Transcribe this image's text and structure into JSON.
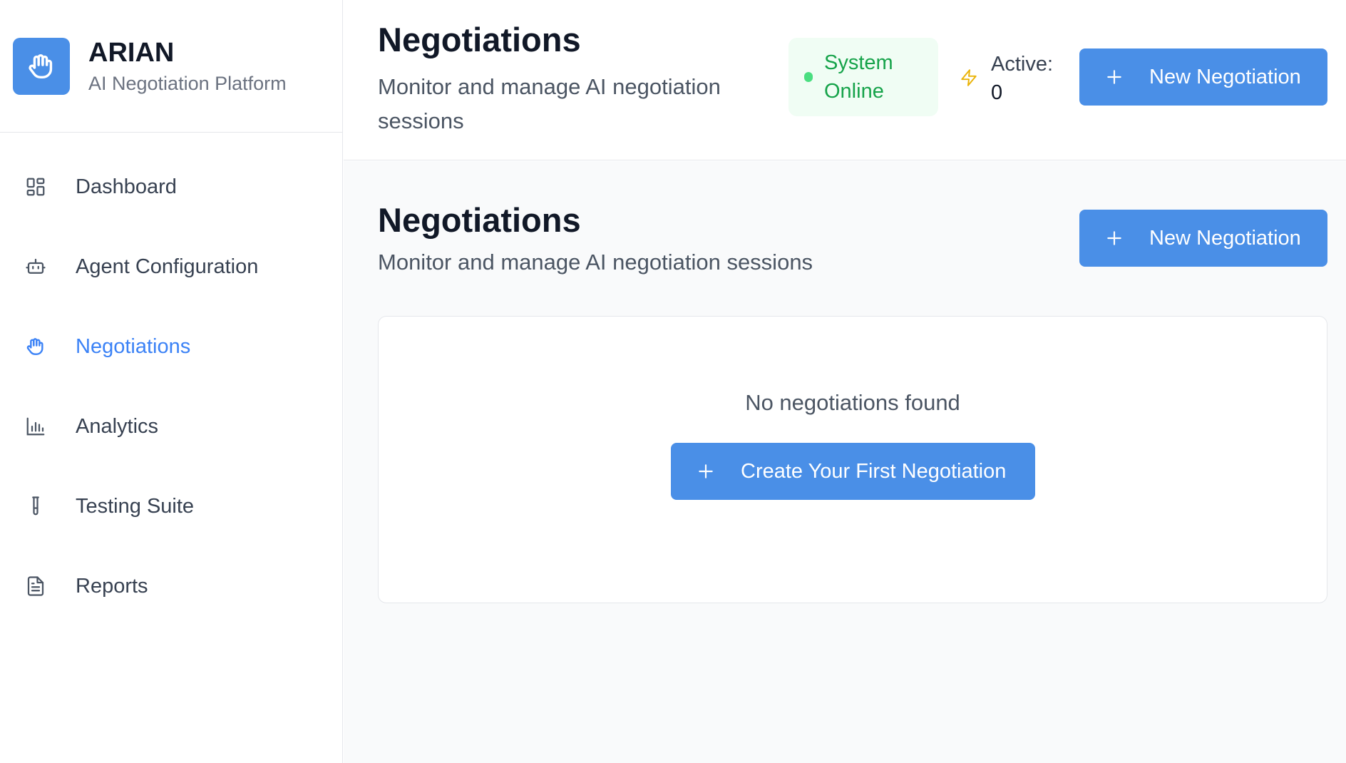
{
  "brand": {
    "name": "ARIAN",
    "subtitle": "AI Negotiation Platform",
    "logo_icon": "hand-icon",
    "accent_color": "#4a8fe7"
  },
  "sidebar": {
    "items": [
      {
        "label": "Dashboard",
        "icon": "grid-icon",
        "active": false
      },
      {
        "label": "Agent Configuration",
        "icon": "robot-icon",
        "active": false
      },
      {
        "label": "Negotiations",
        "icon": "hand-icon",
        "active": true
      },
      {
        "label": "Analytics",
        "icon": "bar-chart-icon",
        "active": false
      },
      {
        "label": "Testing Suite",
        "icon": "test-tube-icon",
        "active": false
      },
      {
        "label": "Reports",
        "icon": "document-icon",
        "active": false
      }
    ]
  },
  "header": {
    "title": "Negotiations",
    "subtitle": "Monitor and manage AI negotiation sessions",
    "status": {
      "line1": "System",
      "line2": "Online",
      "color": "#16a34a"
    },
    "active": {
      "label": "Active:",
      "count": "0"
    },
    "new_button_label": "New Negotiation"
  },
  "main": {
    "title": "Negotiations",
    "subtitle": "Monitor and manage AI negotiation sessions",
    "new_button_label": "New Negotiation",
    "empty_state": {
      "message": "No negotiations found",
      "button_label": "Create Your First Negotiation"
    }
  }
}
